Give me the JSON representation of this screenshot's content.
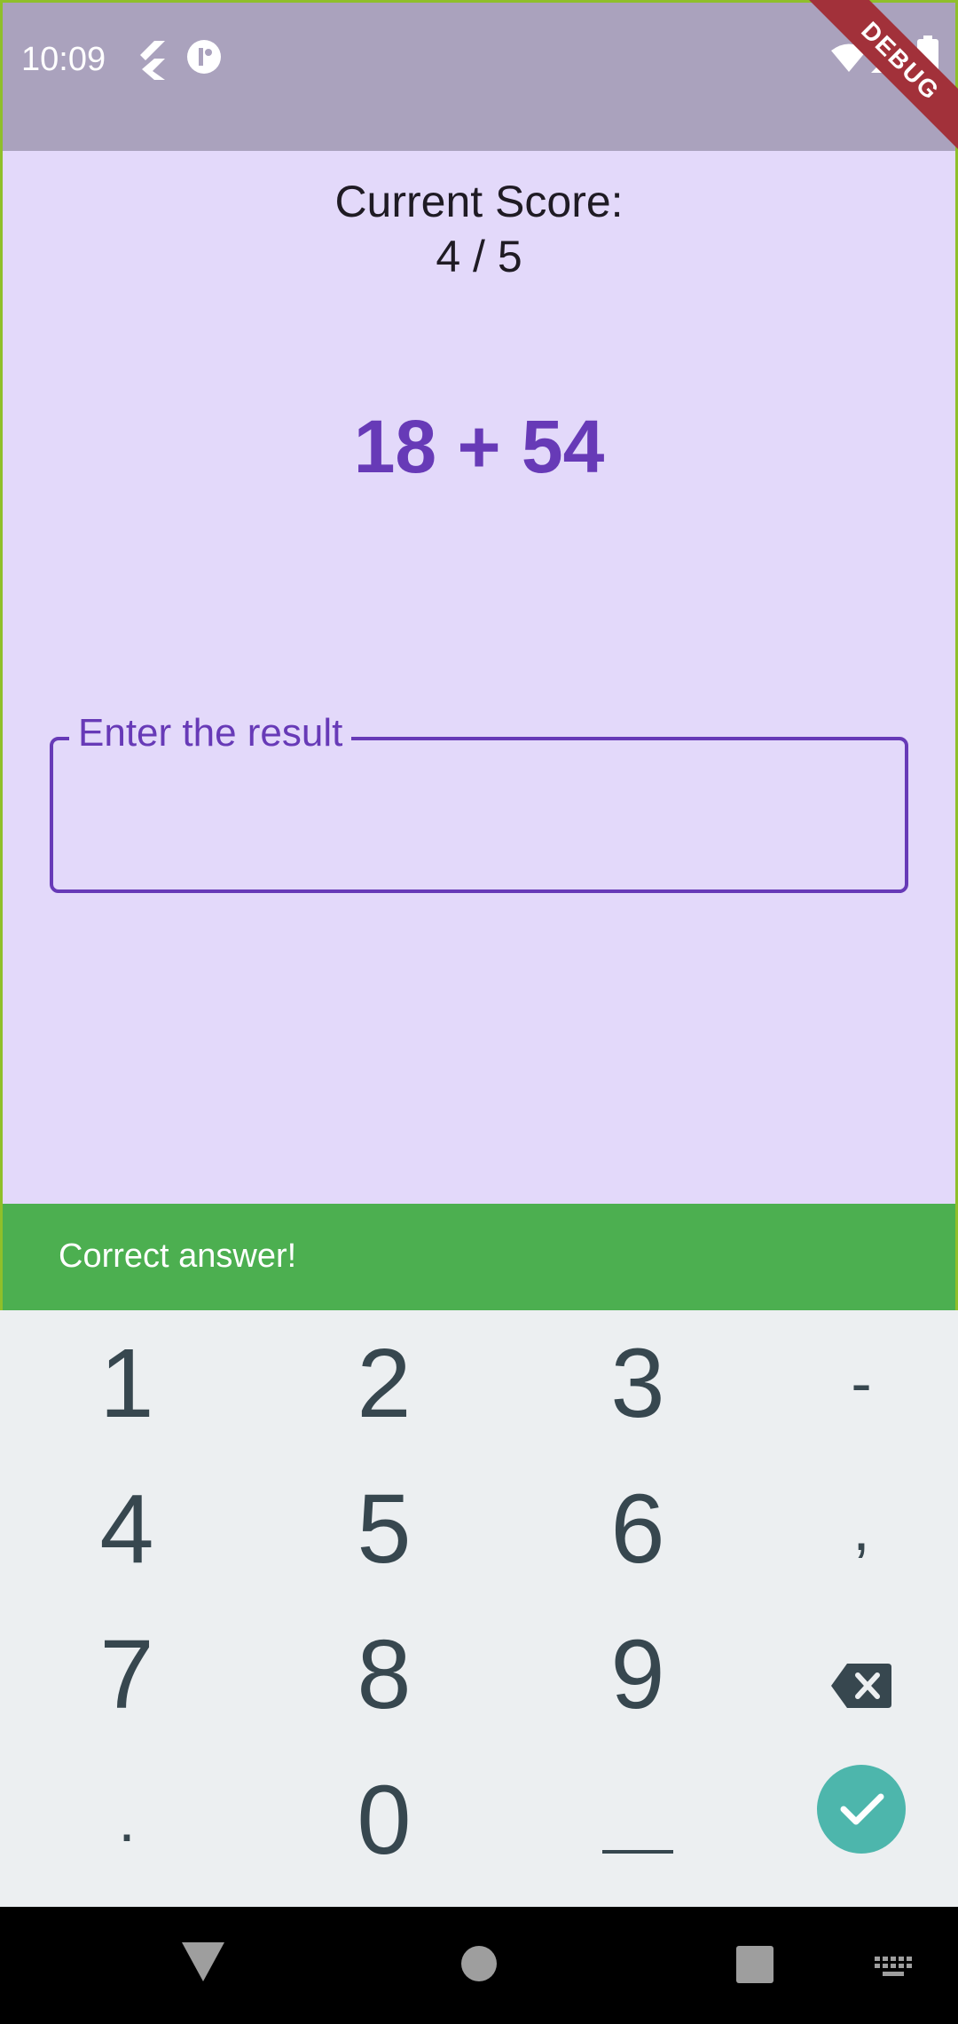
{
  "status_bar": {
    "time": "10:09",
    "icons": [
      "flutter-icon",
      "app-notification-icon",
      "wifi-icon",
      "signal-icon",
      "battery-icon"
    ],
    "debug_label": "DEBUG"
  },
  "score": {
    "title": "Current Score:",
    "value": "4 / 5"
  },
  "question": "18 + 54",
  "answer_input": {
    "label": "Enter the result",
    "value": ""
  },
  "snackbar": {
    "text": "Correct answer!",
    "color": "#4caf50"
  },
  "keyboard": {
    "rows": [
      [
        "1",
        "2",
        "3",
        "-"
      ],
      [
        "4",
        "5",
        "6",
        ","
      ],
      [
        "7",
        "8",
        "9",
        "backspace-icon"
      ],
      [
        ".",
        "0",
        "space-icon",
        "done-check-icon"
      ]
    ]
  },
  "nav_bar": {
    "buttons": [
      "back-icon",
      "home-icon",
      "recents-icon",
      "keyboard-switch-icon"
    ]
  },
  "colors": {
    "accent": "#673ab7",
    "background": "#e3d9fa",
    "keyboard_done": "#4db6ac"
  }
}
